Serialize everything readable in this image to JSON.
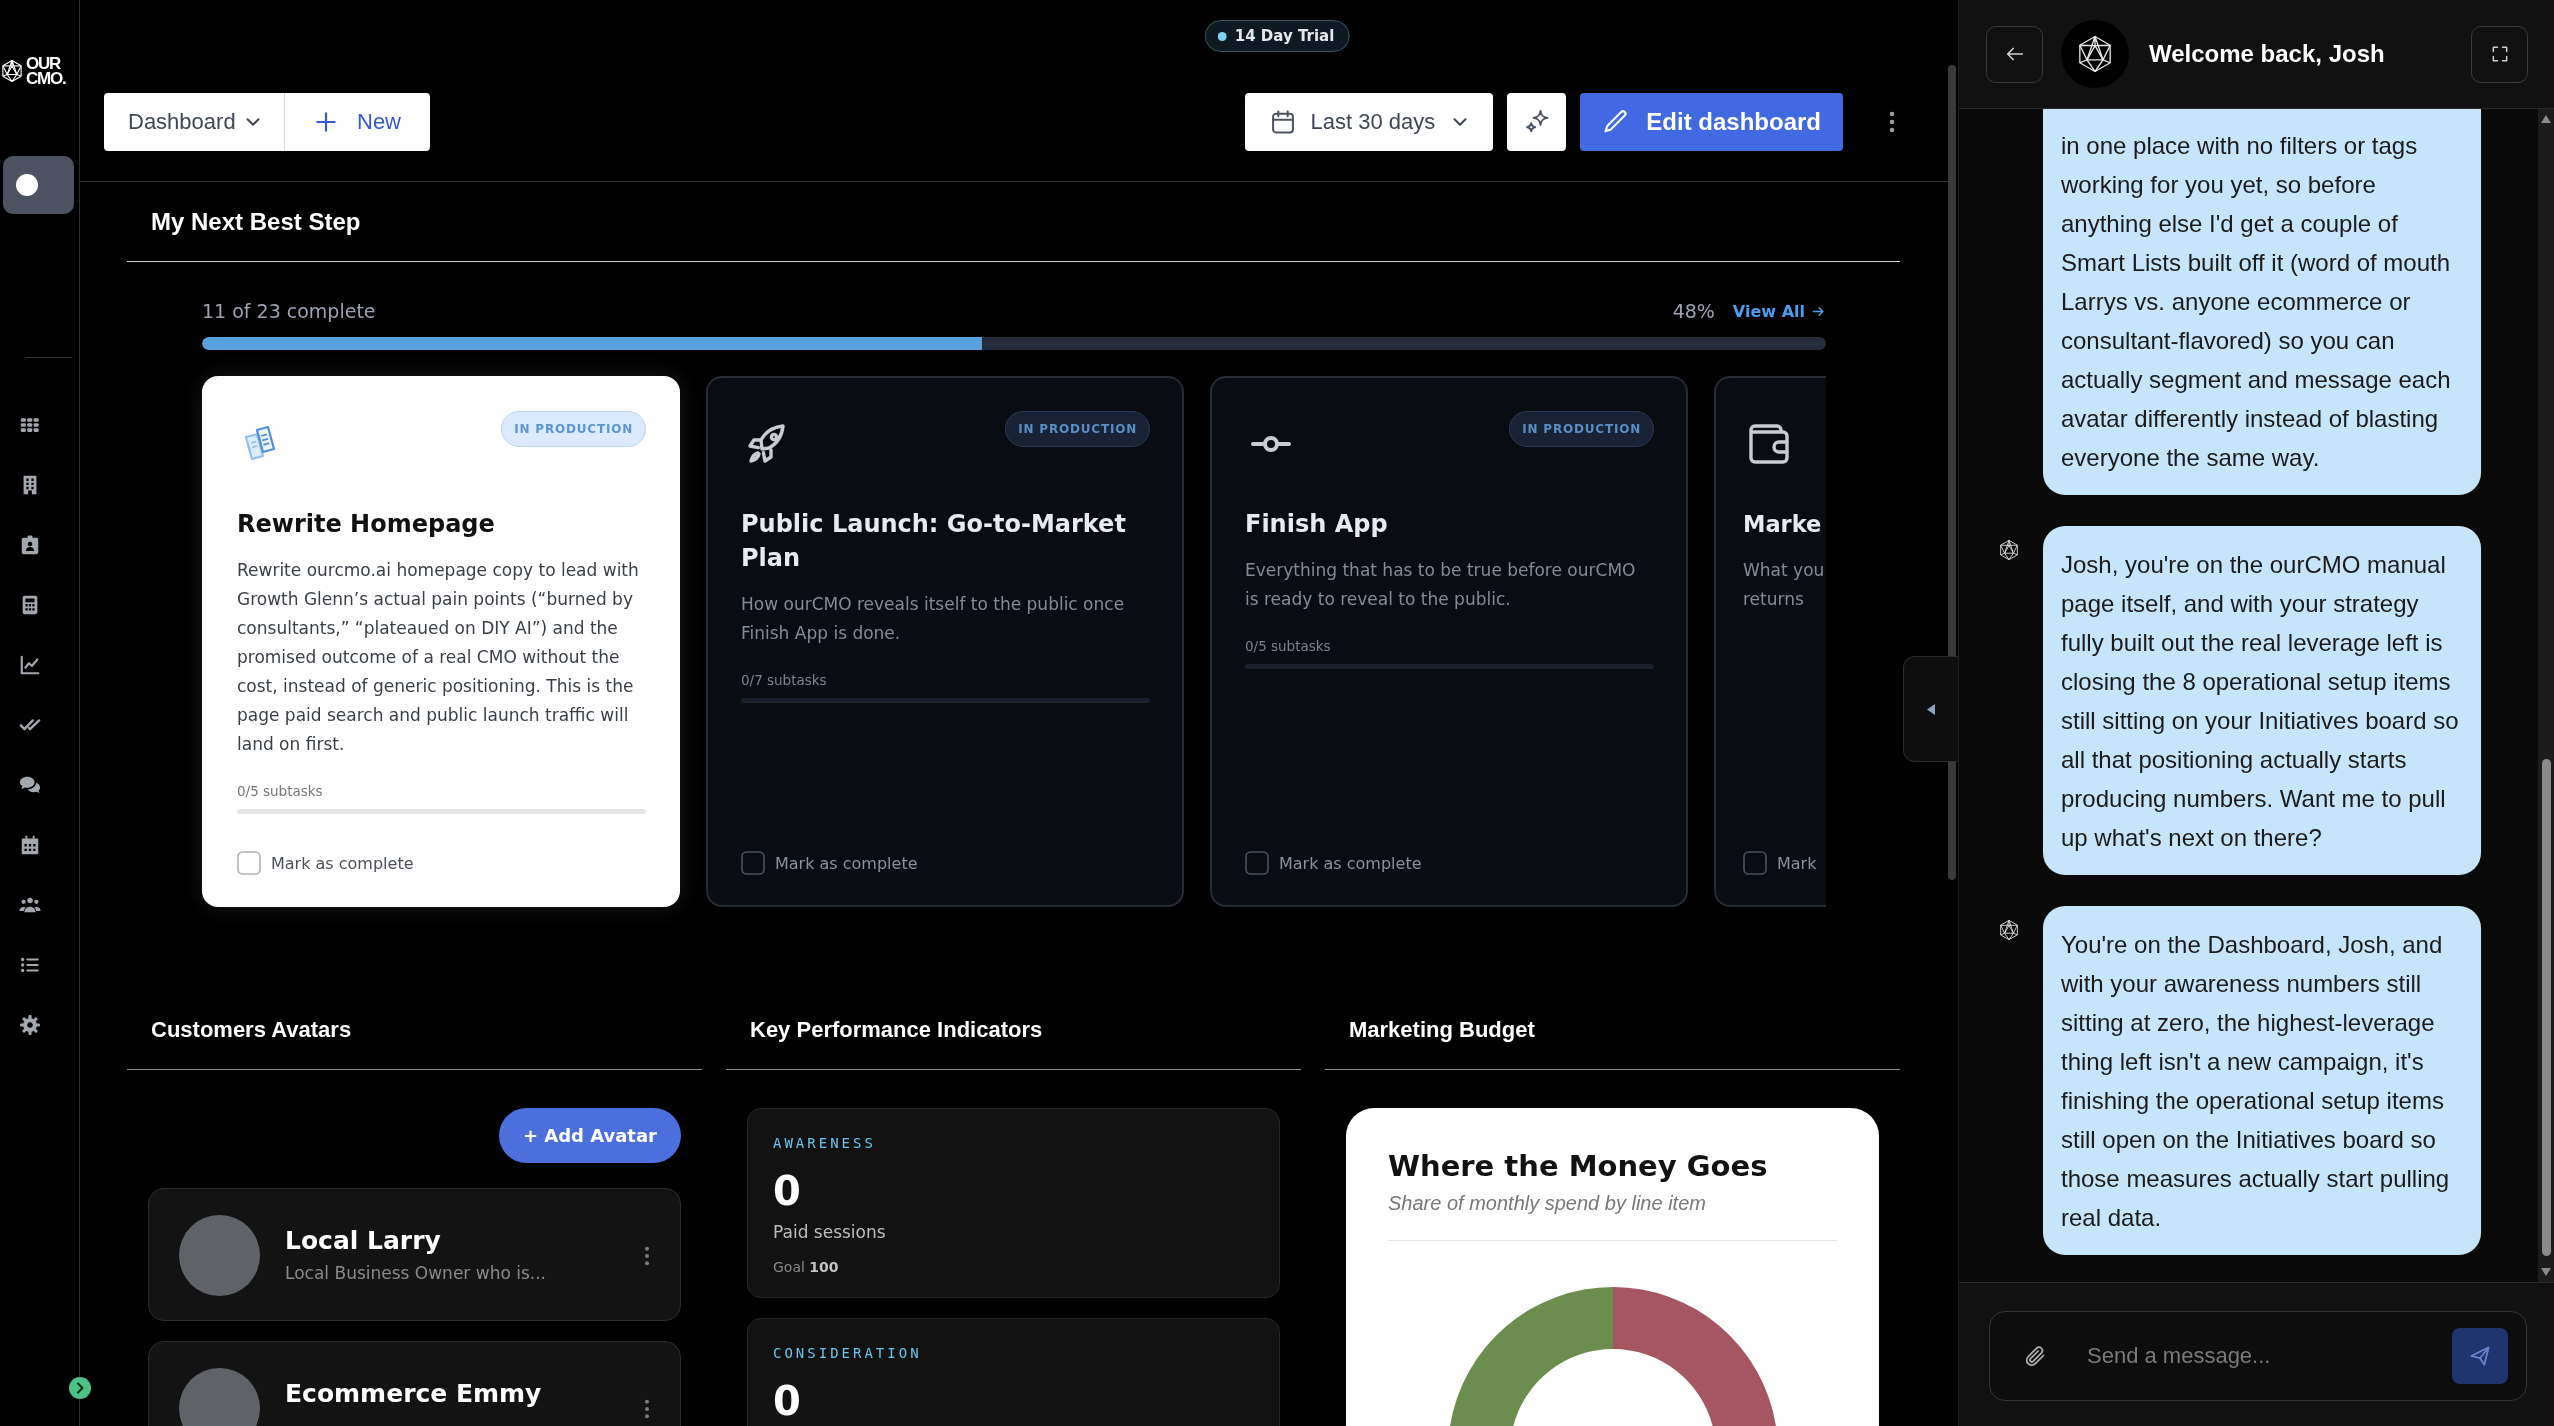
{
  "sidebar": {
    "logo": {
      "lines": [
        "OUR",
        "CMO."
      ]
    },
    "toggle": {
      "on": false
    }
  },
  "trial_badge": {
    "label": "14 Day Trial"
  },
  "toolbar": {
    "view_select": {
      "label": "Dashboard"
    },
    "new_button": {
      "label": "New"
    },
    "date_range": {
      "label": "Last 30 days"
    },
    "edit_button": {
      "label": "Edit dashboard"
    }
  },
  "next_best_step": {
    "title": "My Next Best Step",
    "progress": {
      "summary": "11 of 23 complete",
      "percent": "48%",
      "level": 0.48
    },
    "view_all": "View All",
    "cards": [
      {
        "badge": "IN PRODUCTION",
        "title": "Rewrite Homepage",
        "description": "Rewrite ourcmo.ai homepage copy to lead with Growth Glenn’s actual pain points (“burned by consultants,” “plateaued on DIY AI”) and the promised outcome of a real CMO without the cost, instead of generic positioning. This is the page paid search and public launch traffic will land on first.",
        "subtasks": {
          "label": "0/5 subtasks"
        },
        "complete_label": "Mark as complete",
        "checked": false,
        "selected": true
      },
      {
        "badge": "IN PRODUCTION",
        "title": "Public Launch: Go-to-Market Plan",
        "description": "How ourCMO reveals itself to the public once Finish App is done.",
        "subtasks": {
          "label": "0/7 subtasks"
        },
        "complete_label": "Mark as complete",
        "checked": false,
        "selected": false
      },
      {
        "badge": "IN PRODUCTION",
        "title": "Finish App",
        "description": "Everything that has to be true before ourCMO is ready to reveal to the public.",
        "subtasks": {
          "label": "0/5 subtasks"
        },
        "complete_label": "Mark as complete",
        "checked": false,
        "selected": false
      },
      {
        "title": "Marke",
        "description": "What you returns",
        "complete_label": "Mark",
        "checked": false,
        "selected": false
      }
    ]
  },
  "customer_avatars": {
    "title": "Customers Avatars",
    "add_button": "+ Add Avatar",
    "avatars": [
      {
        "name": "Local Larry",
        "description": "Local Business Owner who is..."
      },
      {
        "name": "Ecommerce Emmy"
      }
    ]
  },
  "kpis": {
    "title": "Key Performance Indicators",
    "items": [
      {
        "label": "AWARENESS",
        "value": "0",
        "metric": "Paid sessions",
        "goal": "Goal **100**"
      },
      {
        "label": "CONSIDERATION",
        "value": "0"
      }
    ]
  },
  "marketing_budget": {
    "title": "Marketing Budget",
    "card": {
      "title": "Where the Money Goes",
      "subtitle": "Share of monthly spend by line item"
    }
  },
  "chat": {
    "title": "Welcome back, Josh",
    "messages": [
      {
        "text": "in one place with no filters or tags working for you yet, so before anything else I'd get a couple of Smart Lists built off it (word of mouth Larrys vs. anyone ecommerce or consultant-flavored) so you can actually segment and message each avatar differently instead of blasting everyone the same way.",
        "show_icon": false
      },
      {
        "text": "Josh, you're on the ourCMO manual page itself, and with your strategy fully built out the real leverage left is closing the 8 operational setup items still sitting on your Initiatives board so all that positioning actually starts producing numbers. Want me to pull up what's next on there?",
        "show_icon": true
      },
      {
        "text": "You're on the Dashboard, Josh, and with your awareness numbers still sitting at zero, the highest-leverage thing left isn't a new campaign, it's finishing the operational setup items still open on the Initiatives board so those measures actually start pulling real data.",
        "show_icon": true
      }
    ],
    "input": {
      "placeholder": "Send a message..."
    },
    "send_button": {
      "disabled": true
    }
  }
}
